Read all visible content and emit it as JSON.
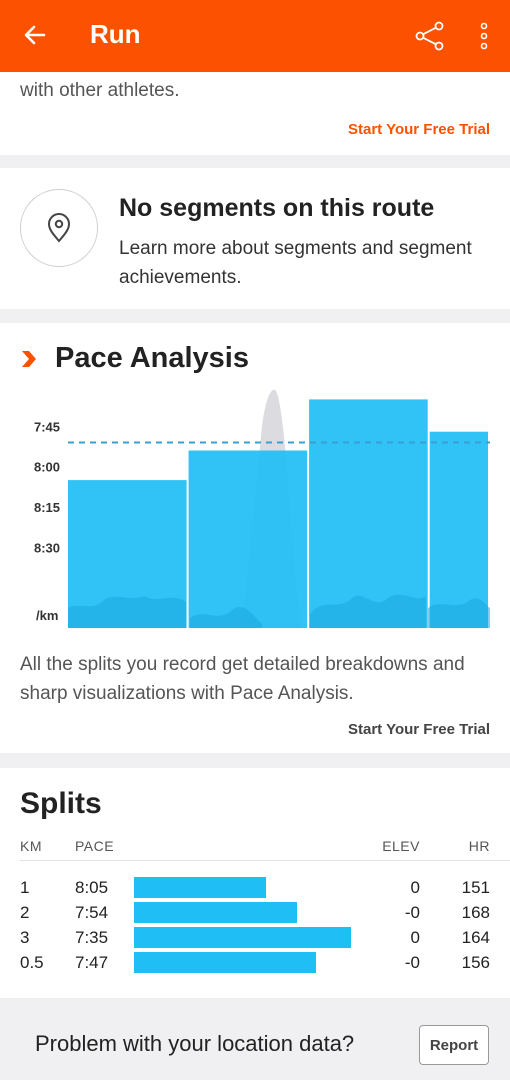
{
  "app_bar": {
    "title": "Run",
    "background": "#fc5200",
    "icons": [
      "back-arrow-icon",
      "share-icon",
      "more-vertical-icon"
    ]
  },
  "premium_card": {
    "text": "with other athletes.",
    "trial_link": "Start Your Free Trial"
  },
  "segments": {
    "icon": "location-pin-icon",
    "title": "No segments on this route",
    "description": "Learn more about segments and segment achievements."
  },
  "pace_analysis": {
    "title": "Pace Analysis",
    "description": "All the splits you record get detailed breakdowns and sharp visualizations with Pace Analysis.",
    "trial_link": "Start Your Free Trial"
  },
  "chart_data": {
    "type": "bar",
    "y_ticks": [
      "7:45",
      "8:00",
      "8:15",
      "8:30"
    ],
    "y_unit": "/km",
    "ylim_seconds_per_km": [
      540,
      450
    ],
    "categories": [
      "1",
      "2",
      "3",
      "0.5"
    ],
    "widths_km": [
      1,
      1,
      1,
      0.5
    ],
    "pace_labels": [
      "8:05",
      "7:54",
      "7:35",
      "7:47"
    ],
    "values_seconds_per_km": [
      485,
      474,
      455,
      467
    ],
    "average_pace_seconds_per_km": 471,
    "colors": {
      "bar": "#1fbef5",
      "average_line": "#3a9fd6",
      "overlay": "#cfcfd3"
    }
  },
  "splits": {
    "title": "Splits",
    "columns": {
      "km": "KM",
      "pace": "PACE",
      "elev": "ELEV",
      "hr": "HR"
    },
    "rows": [
      {
        "km": "1",
        "pace": "8:05",
        "pace_fraction": 0.61,
        "elev": "0",
        "hr": "151"
      },
      {
        "km": "2",
        "pace": "7:54",
        "pace_fraction": 0.75,
        "elev": "-0",
        "hr": "168"
      },
      {
        "km": "3",
        "pace": "7:35",
        "pace_fraction": 1.0,
        "elev": "0",
        "hr": "164"
      },
      {
        "km": "0.5",
        "pace": "7:47",
        "pace_fraction": 0.84,
        "elev": "-0",
        "hr": "156"
      }
    ]
  },
  "report": {
    "question": "Problem with your location data?",
    "button": "Report"
  }
}
